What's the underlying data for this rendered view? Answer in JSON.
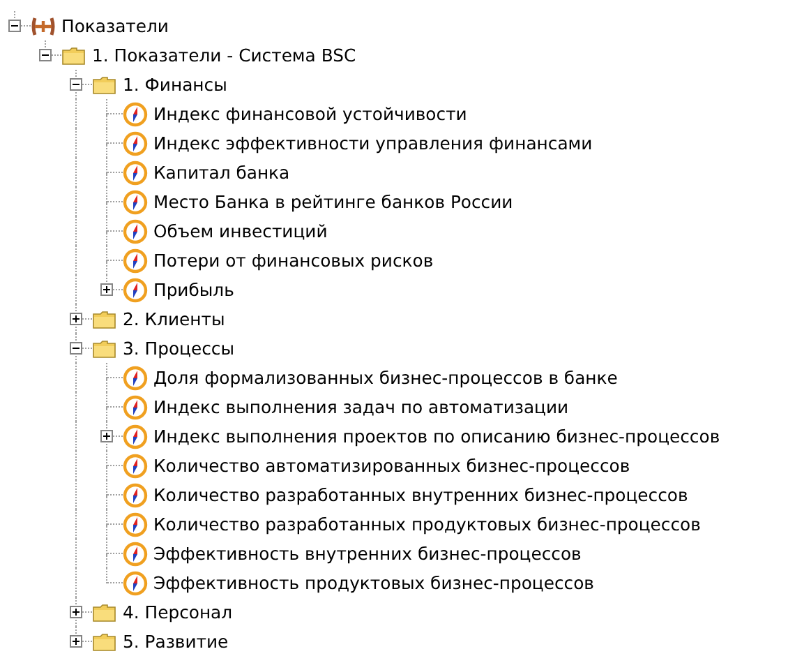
{
  "tree": {
    "label": "Показатели",
    "kind": "root",
    "expanded": true,
    "children": [
      {
        "label": "1. Показатели - Система BSC",
        "kind": "folder",
        "expanded": true,
        "children": [
          {
            "label": "1. Финансы",
            "kind": "folder",
            "expanded": true,
            "children": [
              {
                "label": "Индекс финансовой устойчивости",
                "kind": "indicator"
              },
              {
                "label": "Индекс эффективности управления финансами",
                "kind": "indicator"
              },
              {
                "label": "Капитал банка",
                "kind": "indicator"
              },
              {
                "label": "Место Банка в рейтинге банков России",
                "kind": "indicator"
              },
              {
                "label": "Объем инвестиций",
                "kind": "indicator"
              },
              {
                "label": "Потери от финансовых рисков",
                "kind": "indicator"
              },
              {
                "label": "Прибыль",
                "kind": "indicator",
                "expanded": false
              }
            ]
          },
          {
            "label": "2. Клиенты",
            "kind": "folder",
            "expanded": false
          },
          {
            "label": "3. Процессы",
            "kind": "folder",
            "expanded": true,
            "children": [
              {
                "label": "Доля формализованных бизнес-процессов в банке",
                "kind": "indicator"
              },
              {
                "label": "Индекс выполнения задач по автоматизации",
                "kind": "indicator"
              },
              {
                "label": "Индекс выполнения проектов по описанию бизнес-процессов",
                "kind": "indicator",
                "expanded": false
              },
              {
                "label": "Количество автоматизированных бизнес-процессов",
                "kind": "indicator"
              },
              {
                "label": "Количество разработанных внутренних бизнес-процессов",
                "kind": "indicator"
              },
              {
                "label": "Количество разработанных продуктовых бизнес-процессов",
                "kind": "indicator"
              },
              {
                "label": "Эффективность внутренних бизнес-процессов",
                "kind": "indicator"
              },
              {
                "label": "Эффективность продуктовых бизнес-процессов",
                "kind": "indicator"
              }
            ]
          },
          {
            "label": "4. Персонал",
            "kind": "folder",
            "expanded": false
          },
          {
            "label": "5. Развитие",
            "kind": "folder",
            "expanded": false
          }
        ]
      }
    ]
  }
}
